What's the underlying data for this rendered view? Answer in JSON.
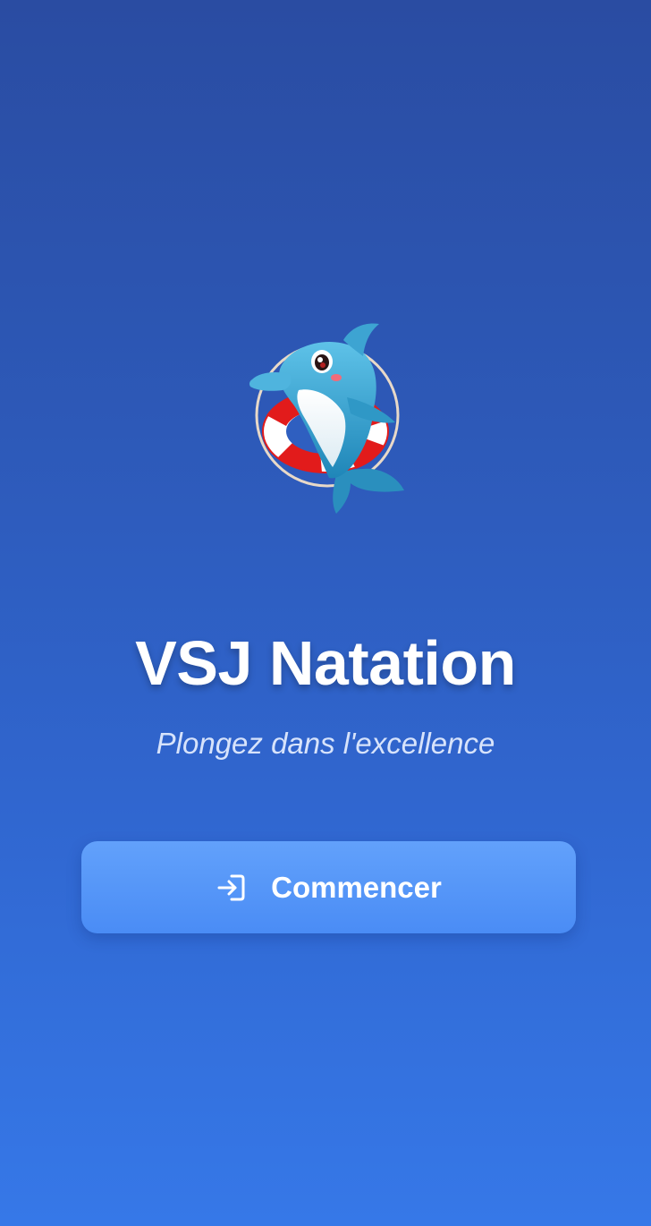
{
  "app": {
    "title": "VSJ Natation",
    "tagline": "Plongez dans l'excellence"
  },
  "logo": {
    "icon": "dolphin-lifebuoy-icon"
  },
  "start_button": {
    "label": "Commencer",
    "icon": "login-icon"
  },
  "colors": {
    "background_top": "#2a4ca2",
    "background_bottom": "#3678e8",
    "button": "#5596f8",
    "text": "#ffffff"
  }
}
